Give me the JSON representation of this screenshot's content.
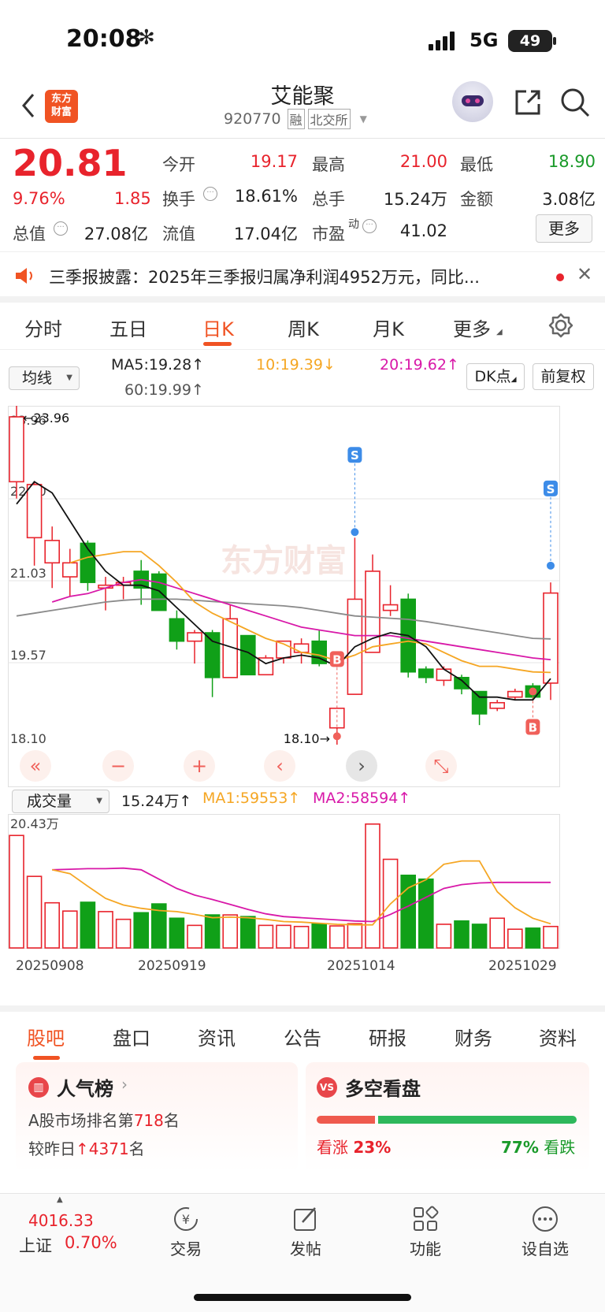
{
  "status": {
    "time": "20:08",
    "network": "5G",
    "battery": "49"
  },
  "header": {
    "name": "艾能聚",
    "code": "920770",
    "tag1": "融",
    "tag2": "北交所",
    "logo_text": "东方\n财富"
  },
  "quote": {
    "price": "20.81",
    "pct": "9.76%",
    "chg": "1.85",
    "open_l": "今开",
    "open": "19.17",
    "high_l": "最高",
    "high": "21.00",
    "low_l": "最低",
    "low": "18.90",
    "turn_l": "换手",
    "turn": "18.61%",
    "vol_l": "总手",
    "vol": "15.24万",
    "amt_l": "金额",
    "amt": "3.08亿",
    "mcap_l": "总值",
    "mcap": "27.08亿",
    "fmcap_l": "流值",
    "fmcap": "17.04亿",
    "pe_l": "市盈",
    "pe_sup": "动",
    "pe": "41.02",
    "more": "更多"
  },
  "notice": {
    "text": "三季报披露：2025年三季报归属净利润4952万元，同比..."
  },
  "period_tabs": [
    "分时",
    "五日",
    "日K",
    "周K",
    "月K",
    "更多"
  ],
  "ma_bar": {
    "select": "均线",
    "ma5": "MA5:19.28↑",
    "ma10": "10:19.39↓",
    "ma20": "20:19.62↑",
    "ma60": "60:19.99↑",
    "dk": "DK点",
    "fq": "前复权"
  },
  "kline": {
    "y_labels": [
      "23.96",
      "22.50",
      "21.03",
      "19.57",
      "18.10"
    ],
    "max_mark": "←23.96",
    "min_mark": "18.10→"
  },
  "vol_bar": {
    "select": "成交量",
    "vol": "15.24万↑",
    "ma1": "MA1:59553↑",
    "ma2": "MA2:58594↑",
    "ymax": "20.43万"
  },
  "dates": [
    "20250908",
    "20250919",
    "20251014",
    "20251029"
  ],
  "chart_data": {
    "type": "candlestick",
    "candles": [
      {
        "o": 22.8,
        "c": 23.96,
        "h": 24.2,
        "l": 22.5
      },
      {
        "o": 21.8,
        "c": 22.75,
        "h": 22.8,
        "l": 21.3
      },
      {
        "o": 21.35,
        "c": 21.75,
        "h": 22.0,
        "l": 20.9
      },
      {
        "o": 21.1,
        "c": 21.35,
        "h": 21.6,
        "l": 20.75
      },
      {
        "o": 21.7,
        "c": 21.0,
        "h": 21.75,
        "l": 20.85
      },
      {
        "o": 20.9,
        "c": 20.95,
        "h": 21.1,
        "l": 20.5
      },
      {
        "o": 20.95,
        "c": 21.0,
        "h": 21.1,
        "l": 20.7
      },
      {
        "o": 21.2,
        "c": 20.9,
        "h": 21.4,
        "l": 20.6
      },
      {
        "o": 21.15,
        "c": 20.5,
        "h": 21.2,
        "l": 20.5
      },
      {
        "o": 20.35,
        "c": 19.95,
        "h": 20.5,
        "l": 19.8
      },
      {
        "o": 19.95,
        "c": 20.1,
        "h": 20.15,
        "l": 19.55
      },
      {
        "o": 20.1,
        "c": 19.3,
        "h": 20.15,
        "l": 18.95
      },
      {
        "o": 19.3,
        "c": 20.35,
        "h": 20.6,
        "l": 19.3
      },
      {
        "o": 20.05,
        "c": 19.35,
        "h": 20.05,
        "l": 19.35
      },
      {
        "o": 19.35,
        "c": 19.65,
        "h": 19.7,
        "l": 19.35
      },
      {
        "o": 19.65,
        "c": 19.95,
        "h": 19.95,
        "l": 19.55
      },
      {
        "o": 19.75,
        "c": 19.9,
        "h": 20.0,
        "l": 19.55
      },
      {
        "o": 19.95,
        "c": 19.55,
        "h": 20.15,
        "l": 19.5
      },
      {
        "o": 18.4,
        "c": 18.75,
        "h": 18.75,
        "l": 18.1
      },
      {
        "o": 19.0,
        "c": 20.7,
        "h": 21.8,
        "l": 19.0
      },
      {
        "o": 19.75,
        "c": 21.2,
        "h": 21.5,
        "l": 19.75
      },
      {
        "o": 20.5,
        "c": 20.6,
        "h": 20.95,
        "l": 20.4
      },
      {
        "o": 20.7,
        "c": 19.4,
        "h": 20.8,
        "l": 19.3
      },
      {
        "o": 19.45,
        "c": 19.3,
        "h": 19.5,
        "l": 19.2
      },
      {
        "o": 19.25,
        "c": 19.45,
        "h": 19.5,
        "l": 19.15
      },
      {
        "o": 19.3,
        "c": 19.1,
        "h": 19.35,
        "l": 19.0
      },
      {
        "o": 19.05,
        "c": 18.65,
        "h": 19.05,
        "l": 18.45
      },
      {
        "o": 18.75,
        "c": 18.85,
        "h": 18.9,
        "l": 18.7
      },
      {
        "o": 18.95,
        "c": 19.05,
        "h": 19.1,
        "l": 18.9
      },
      {
        "o": 19.15,
        "c": 18.95,
        "h": 19.2,
        "l": 18.9
      },
      {
        "o": 19.2,
        "c": 20.81,
        "h": 21.0,
        "l": 18.9
      }
    ],
    "ma5": [
      22.4,
      22.8,
      22.6,
      22.1,
      21.6,
      21.2,
      20.95,
      20.95,
      20.85,
      20.55,
      20.25,
      19.95,
      19.85,
      19.75,
      19.55,
      19.65,
      19.7,
      19.65,
      19.5,
      19.85,
      20.0,
      20.1,
      20.05,
      19.85,
      19.45,
      19.25,
      18.95,
      18.95,
      18.9,
      18.9,
      19.28
    ],
    "ma10": [
      null,
      null,
      null,
      21.35,
      21.45,
      21.5,
      21.55,
      21.55,
      21.3,
      21.0,
      20.65,
      20.45,
      20.3,
      20.15,
      20.0,
      19.9,
      19.75,
      19.7,
      19.6,
      19.7,
      19.85,
      19.9,
      19.95,
      19.9,
      19.75,
      19.6,
      19.5,
      19.5,
      19.45,
      19.4,
      19.39
    ],
    "ma20": [
      null,
      null,
      20.65,
      20.75,
      20.8,
      20.9,
      21.0,
      21.05,
      21.0,
      20.9,
      20.8,
      20.7,
      20.6,
      20.5,
      20.4,
      20.3,
      20.2,
      20.15,
      20.1,
      20.05,
      20.05,
      20.05,
      20.0,
      19.95,
      19.9,
      19.85,
      19.8,
      19.75,
      19.7,
      19.65,
      19.62
    ],
    "ma60": [
      20.4,
      20.45,
      20.5,
      20.55,
      20.6,
      20.65,
      20.68,
      20.7,
      20.7,
      20.7,
      20.68,
      20.66,
      20.64,
      20.62,
      20.6,
      20.58,
      20.55,
      20.5,
      20.45,
      20.4,
      20.38,
      20.36,
      20.34,
      20.3,
      20.25,
      20.2,
      20.15,
      20.1,
      20.05,
      20.0,
      19.99
    ],
    "vol": [
      20.43,
      13.0,
      8.2,
      6.7,
      8.3,
      6.6,
      5.2,
      6.4,
      8.0,
      5.4,
      4.1,
      6.0,
      6.0,
      5.7,
      4.1,
      4.1,
      3.9,
      4.4,
      4.0,
      4.4,
      22.5,
      16.1,
      13.2,
      12.5,
      4.3,
      4.9,
      4.3,
      5.4,
      3.4,
      3.6,
      3.9,
      16.8
    ],
    "vol_ma1": [
      null,
      null,
      14.2,
      13.5,
      11.2,
      9.0,
      7.8,
      7.2,
      6.8,
      6.6,
      6.1,
      5.5,
      5.6,
      5.5,
      5.2,
      4.8,
      4.7,
      4.5,
      4.3,
      4.2,
      4.2,
      8.0,
      10.9,
      12.4,
      15.2,
      15.8,
      15.8,
      10.2,
      7.3,
      5.4,
      4.4,
      6.6
    ],
    "vol_ma2": [
      null,
      null,
      14.2,
      14.3,
      14.4,
      14.4,
      14.5,
      14.2,
      12.5,
      10.8,
      9.6,
      8.8,
      7.9,
      7.0,
      6.2,
      5.7,
      5.5,
      5.3,
      5.1,
      4.9,
      4.8,
      6.1,
      7.6,
      9.2,
      10.8,
      11.5,
      11.8,
      11.9,
      11.9,
      11.9,
      11.9,
      9.6
    ]
  },
  "bottom_tabs": [
    "股吧",
    "盘口",
    "资讯",
    "公告",
    "研报",
    "财务",
    "资料"
  ],
  "cards": {
    "pop_title": "人气榜",
    "pop_line1a": "A股市场排名第",
    "pop_rank": "718",
    "pop_line1b": "名",
    "pop_line2a": "较昨日",
    "pop_delta": "4371",
    "pop_line2b": "名",
    "vs_title": "多空看盘",
    "up_l": "看涨",
    "up": "23%",
    "down": "77%",
    "down_l": "看跌"
  },
  "footer": {
    "index": "4016.33",
    "index_name": "上证",
    "index_pct": "0.70%",
    "trade": "交易",
    "post": "发帖",
    "func": "功能",
    "watch": "设自选"
  }
}
